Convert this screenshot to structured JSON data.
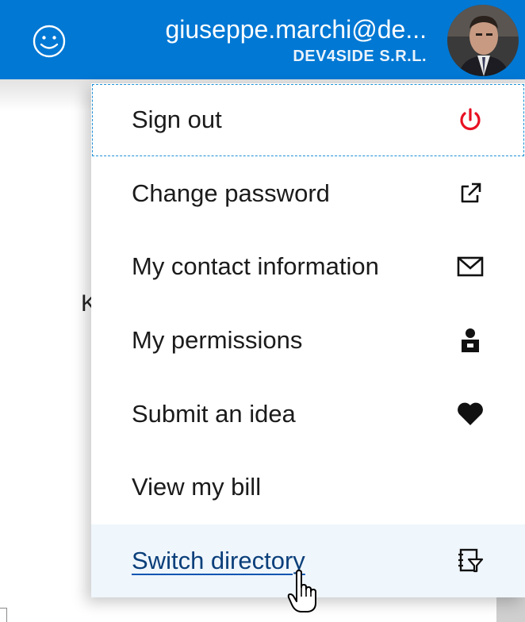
{
  "header": {
    "user_email": "giuseppe.marchi@de...",
    "user_tenant": "DEV4SIDE S.R.L.",
    "feedback_icon": "smiley-icon",
    "avatar_icon": "user-photo",
    "background_color": "#0078d4"
  },
  "background": {
    "partial_letter": "K"
  },
  "menu": {
    "items": [
      {
        "label": "Sign out",
        "icon": "power-icon",
        "icon_color": "#e81123"
      },
      {
        "label": "Change password",
        "icon": "external-link-icon"
      },
      {
        "label": "My contact information",
        "icon": "mail-icon"
      },
      {
        "label": "My permissions",
        "icon": "permissions-icon"
      },
      {
        "label": "Submit an idea",
        "icon": "heart-icon"
      },
      {
        "label": "View my bill",
        "icon": ""
      },
      {
        "label": "Switch directory",
        "icon": "switch-directory-icon"
      }
    ],
    "focused_item": "Sign out",
    "hovered_item": "Switch directory"
  }
}
